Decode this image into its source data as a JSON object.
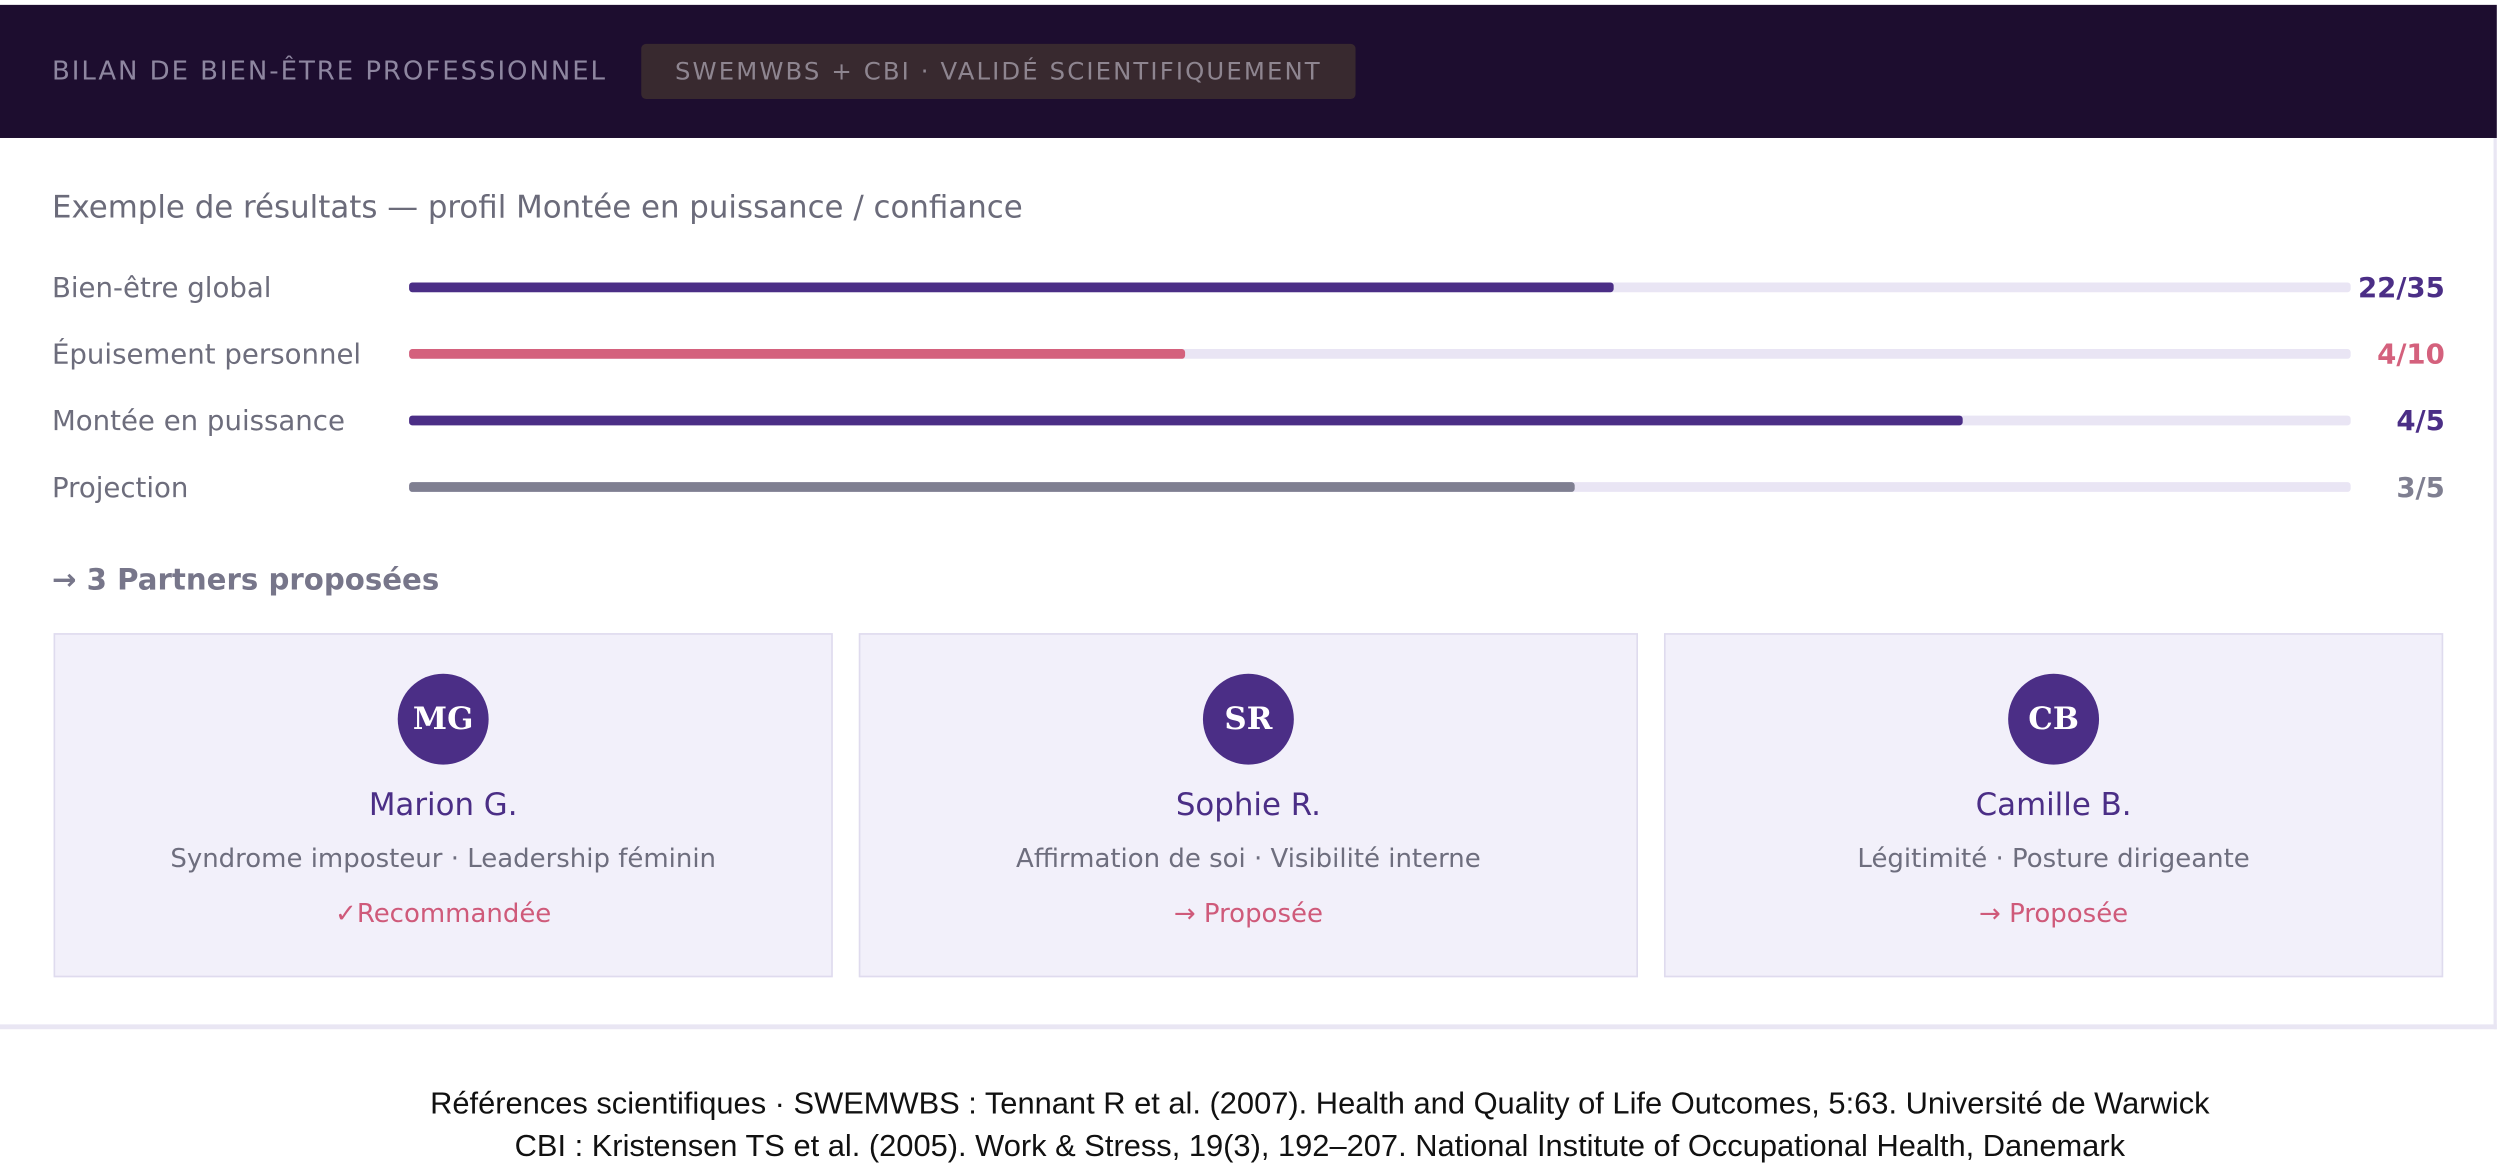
{
  "header": {
    "title": "BILAN DE BIEN-ÊTRE PROFESSIONNEL",
    "badge": "SWEMWBS + CBI · VALIDÉ SCIENTIFIQUEMENT"
  },
  "results": {
    "subtitle": "Exemple de résultats — profil Montée en puissance / confiance",
    "metrics": [
      {
        "label": "Bien-être global",
        "value_text": "22/35",
        "score": 22,
        "max": 35,
        "fill_fraction": 0.62,
        "color": "#4b2e86"
      },
      {
        "label": "Épuisement personnel",
        "value_text": "4/10",
        "score": 4,
        "max": 10,
        "fill_fraction": 0.4,
        "color": "#d4617d"
      },
      {
        "label": "Montée en puissance",
        "value_text": "4/5",
        "score": 4,
        "max": 5,
        "fill_fraction": 0.8,
        "color": "#4b2e86"
      },
      {
        "label": "Projection",
        "value_text": "3/5",
        "score": 3,
        "max": 5,
        "fill_fraction": 0.6,
        "color": "#7f7f91"
      }
    ]
  },
  "partners": {
    "heading": "→ 3 Partners proposées",
    "items": [
      {
        "initials": "MG",
        "name": "Marion G.",
        "tags": "Syndrome imposteur · Leadership féminin",
        "status": "✓Recommandée"
      },
      {
        "initials": "SR",
        "name": "Sophie R.",
        "tags": "Affirmation de soi · Visibilité interne",
        "status": "→ Proposée"
      },
      {
        "initials": "CB",
        "name": "Camille B.",
        "tags": "Légitimité · Posture dirigeante",
        "status": "→ Proposée"
      }
    ]
  },
  "references": {
    "line1": "Références scientifiques · SWEMWBS : Tennant R et al. (2007). Health and Quality of Life Outcomes, 5:63. Université de Warwick",
    "line2": "CBI : Kristensen TS et al. (2005). Work & Stress, 19(3), 192–207. National Institute of Occupational Health, Danemark"
  },
  "colors": {
    "header_bg": "#1d0d2f",
    "brand_purple": "#4b2e86",
    "accent_pink": "#d4617d",
    "neutral_bar": "#7f7f91",
    "track": "#e9e5f4",
    "partner_bg": "#f2f0fa"
  }
}
